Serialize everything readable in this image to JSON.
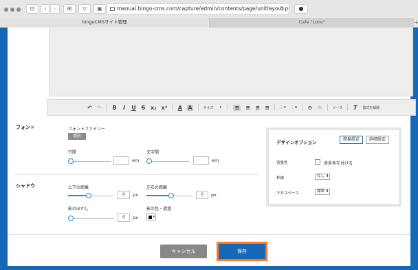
{
  "browser": {
    "url": "manual.bingo-cms.com/capture/admin/contents/page/unitlayout.php?mprev=i...",
    "tabs": [
      "bingoCMSサイト管理",
      "Cafe \"Loos\""
    ]
  },
  "toolbar": {
    "undo": "↶",
    "redo": "↷",
    "bold": "B",
    "italic": "I",
    "underline": "U",
    "strike": "S",
    "subscript": "x₂",
    "superscript": "x²",
    "text_color": "A",
    "bg_color": "A",
    "size": "サイズ",
    "align_left": "≡",
    "align_center": "≡",
    "align_right": "≡",
    "align_justify": "≡",
    "ol": "⋮≡",
    "ul": "⋮≡",
    "link": "⊝",
    "unlink": "⊝",
    "source": "ソース",
    "clear_format": "書式を解除"
  },
  "font_section": {
    "label": "フォント",
    "family_label": "フォントファミリー",
    "select_label": "選択",
    "line_height_label": "行間",
    "letter_spacing_label": "文字間",
    "unit": "em"
  },
  "shadow_section": {
    "label": "シャドウ",
    "vertical_label": "上下の距離",
    "horizontal_label": "左右の距離",
    "blur_label": "影のぼかし",
    "color_label": "影の色・透過",
    "vertical_value": "0",
    "horizontal_value": "0",
    "blur_value": "0",
    "unit": "px",
    "vertical_level": 0.45,
    "horizontal_level": 0.55,
    "blur_level": 0.0
  },
  "design_options": {
    "title": "デザインオプション",
    "simple_btn": "簡易設定",
    "detail_btn": "詳細設定",
    "bg_label": "背景色",
    "bg_checkbox_label": "背景色を付ける",
    "border_label": "枠線",
    "border_value": "なし ⬍",
    "bottom_space_label": "下方スペース",
    "bottom_space_value": "標準 ⬍"
  },
  "footer": {
    "cancel": "キャンセル",
    "save": "保存"
  },
  "colors": {
    "page_bg": "#1468b7",
    "accent": "#1a8fd6",
    "highlight": "#ff7a1e",
    "cancel": "#888888"
  }
}
